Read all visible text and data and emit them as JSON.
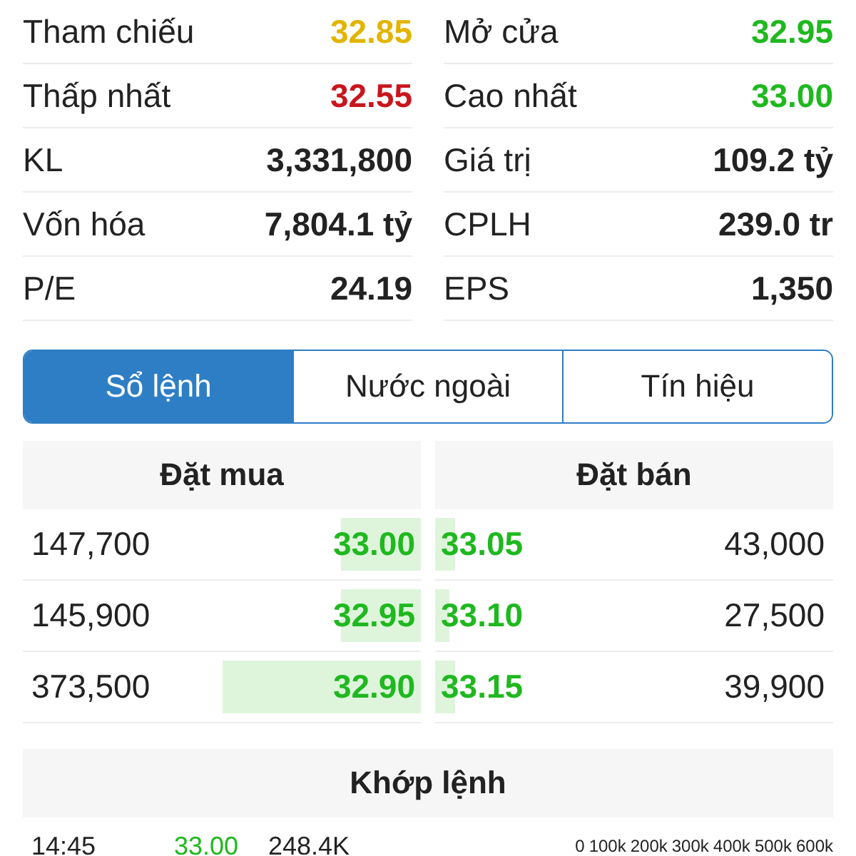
{
  "stats": [
    {
      "label": "Tham chiếu",
      "value": "32.85",
      "color": "#e2b400"
    },
    {
      "label": "Mở cửa",
      "value": "32.95",
      "color": "#1fb81f"
    },
    {
      "label": "Thấp nhất",
      "value": "32.55",
      "color": "#c8161d"
    },
    {
      "label": "Cao nhất",
      "value": "33.00",
      "color": "#1fb81f"
    },
    {
      "label": "KL",
      "value": "3,331,800",
      "color": "#222222"
    },
    {
      "label": "Giá trị",
      "value": "109.2 tỷ",
      "color": "#222222"
    },
    {
      "label": "Vốn hóa",
      "value": "7,804.1 tỷ",
      "color": "#222222"
    },
    {
      "label": "CPLH",
      "value": "239.0 tr",
      "color": "#222222"
    },
    {
      "label": "P/E",
      "value": "24.19",
      "color": "#222222"
    },
    {
      "label": "EPS",
      "value": "1,350",
      "color": "#222222"
    }
  ],
  "tabs": [
    {
      "label": "Sổ lệnh",
      "selected": true
    },
    {
      "label": "Nước ngoài",
      "selected": false
    },
    {
      "label": "Tín hiệu",
      "selected": false
    }
  ],
  "order_book": {
    "bid_title": "Đặt mua",
    "ask_title": "Đặt bán",
    "rows": [
      {
        "bid": {
          "volume": "147,700",
          "price": "33.00",
          "level": 0.2
        },
        "ask": {
          "price": "33.05",
          "level": 0.05,
          "volume": "43,000"
        }
      },
      {
        "bid": {
          "volume": "145,900",
          "price": "32.95",
          "level": 0.2
        },
        "ask": {
          "price": "33.10",
          "level": 0.035,
          "volume": "27,500"
        }
      },
      {
        "bid": {
          "volume": "373,500",
          "price": "32.90",
          "level": 0.5
        },
        "ask": {
          "price": "33.15",
          "level": 0.05,
          "volume": "39,900"
        }
      }
    ]
  },
  "matched": {
    "title": "Khớp lệnh",
    "rows": [
      {
        "time": "14:45",
        "price": "33.00",
        "volume": "248.4K"
      }
    ],
    "axis_ticks": [
      "0",
      "100k",
      "200k",
      "300k",
      "400k",
      "500k",
      "600k"
    ]
  }
}
